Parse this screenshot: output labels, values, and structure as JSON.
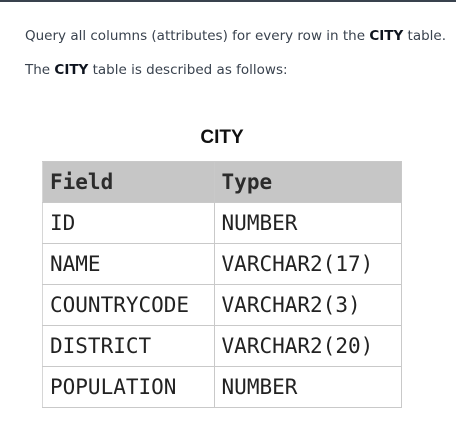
{
  "description": {
    "line1_before": "Query all columns (attributes) for every row in the ",
    "line1_table": "CITY",
    "line1_after": " table.",
    "line2_before": "The ",
    "line2_table": "CITY",
    "line2_after": " table is described as follows:"
  },
  "schema_table": {
    "caption": "CITY",
    "headers": [
      "Field",
      "Type"
    ],
    "rows": [
      [
        "ID",
        "NUMBER"
      ],
      [
        "NAME",
        "VARCHAR2(17)"
      ],
      [
        "COUNTRYCODE",
        "VARCHAR2(3)"
      ],
      [
        "DISTRICT",
        "VARCHAR2(20)"
      ],
      [
        "POPULATION",
        "NUMBER"
      ]
    ]
  }
}
